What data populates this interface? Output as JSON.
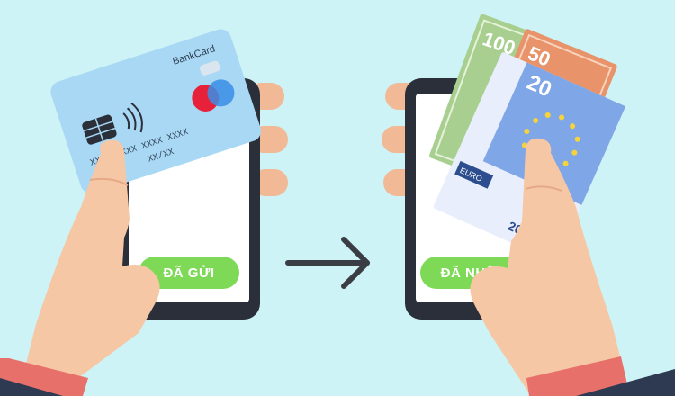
{
  "colors": {
    "background": "#cdf3f6",
    "phone_body": "#2b2f3a",
    "phone_screen": "#ffffff",
    "button_green": "#7ed957",
    "arrow": "#3a3d44",
    "skin": "#f6c7a4",
    "sleeve": "#e8706a",
    "card": "#a9d8f5",
    "note_100": "#a8cf8f",
    "note_50": "#e8936a",
    "note_20": "#7fa6e6"
  },
  "left_phone": {
    "button_label": "ĐÃ GỬI"
  },
  "right_phone": {
    "button_label": "ĐÃ NHẬN"
  },
  "bank_card": {
    "brand": "BankCard",
    "number": "XXXX XXXX XXXX XXXX",
    "expiry": "XX/XX"
  },
  "banknotes": {
    "note_100": "100",
    "note_50": "50",
    "note_20": "20",
    "currency": "EURO",
    "note_20_small": "20"
  },
  "icons": {
    "arrow": "arrow-right-icon",
    "contactless": "contactless-icon",
    "chip": "chip-icon",
    "card_logo": "mastercard-logo-icon"
  }
}
